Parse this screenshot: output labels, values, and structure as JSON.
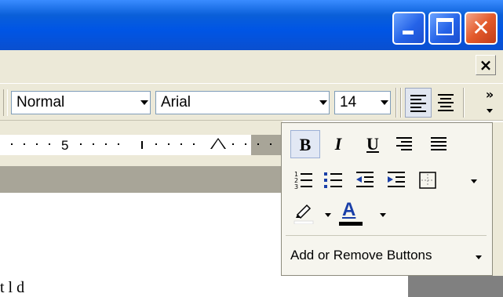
{
  "window": {
    "caption_buttons": {
      "minimize_icon": "minimize-icon",
      "maximize_icon": "maximize-icon",
      "close_icon": "close-icon",
      "close_color": "#e35a2b",
      "title_color": "#0055e5"
    }
  },
  "document": {
    "close_label": "×"
  },
  "toolbar": {
    "style_value": "Normal",
    "font_value": "Arial",
    "size_value": "14",
    "more_buttons_glyph": "»"
  },
  "ruler": {
    "labels": [
      "5"
    ]
  },
  "overflow_menu": {
    "bold_label": "B",
    "italic_label": "I",
    "underline_label": "U",
    "highlight_color": "#ffffff",
    "font_color_label": "A",
    "font_color": "#000000",
    "add_remove_label": "Add or Remove Buttons"
  },
  "body_text": {
    "partial_line": "t   l    d"
  }
}
